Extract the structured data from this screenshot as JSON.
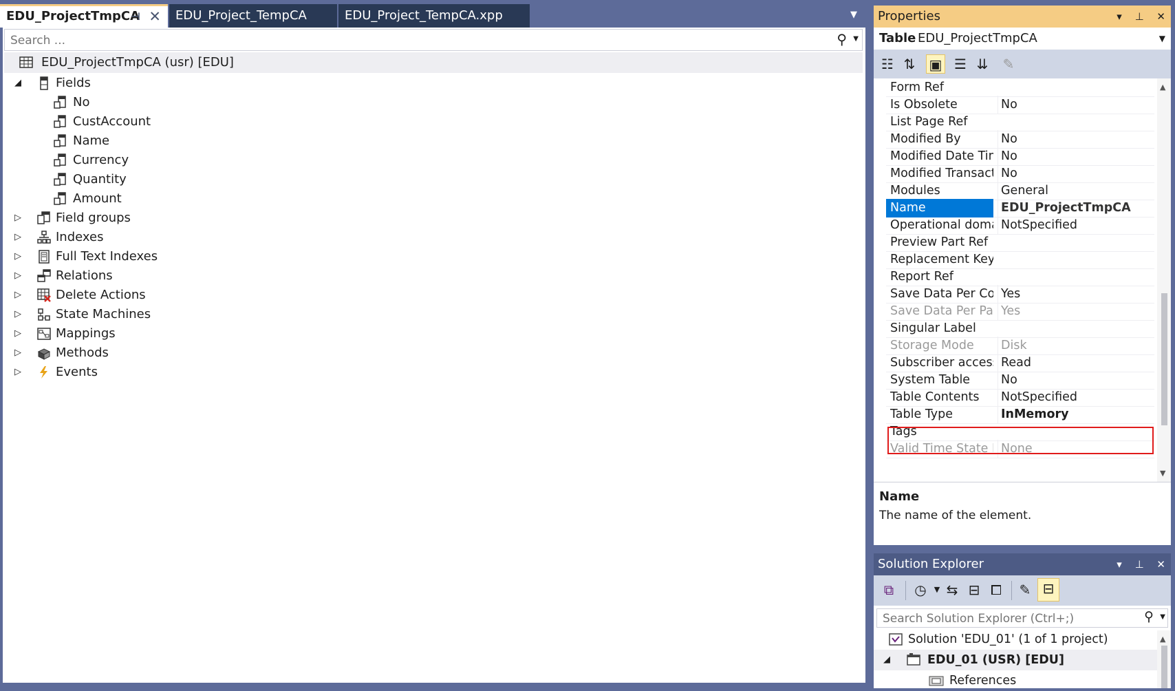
{
  "tabs": [
    {
      "label": "EDU_ProjectTmpCA",
      "active": true
    },
    {
      "label": "EDU_Project_TempCA",
      "active": false
    },
    {
      "label": "EDU_Project_TempCA.xpp",
      "active": false
    }
  ],
  "editor": {
    "search_placeholder": "Search ...",
    "root": "EDU_ProjectTmpCA (usr) [EDU]",
    "fields_node": "Fields",
    "fields": [
      "No",
      "CustAccount",
      "Name",
      "Currency",
      "Quantity",
      "Amount"
    ],
    "nodes": [
      "Field groups",
      "Indexes",
      "Full Text Indexes",
      "Relations",
      "Delete Actions",
      "State Machines",
      "Mappings",
      "Methods",
      "Events"
    ]
  },
  "properties": {
    "title": "Properties",
    "object_kind": "Table",
    "object_name": "EDU_ProjectTmpCA",
    "rows": [
      {
        "name": "Form Ref",
        "value": ""
      },
      {
        "name": "Is Obsolete",
        "value": "No"
      },
      {
        "name": "List Page Ref",
        "value": ""
      },
      {
        "name": "Modified By",
        "value": "No"
      },
      {
        "name": "Modified Date Time",
        "value": "No"
      },
      {
        "name": "Modified TransactionId",
        "value": "No"
      },
      {
        "name": "Modules",
        "value": "General"
      },
      {
        "name": "Name",
        "value": "EDU_ProjectTmpCA"
      },
      {
        "name": "Operational domain",
        "value": "NotSpecified"
      },
      {
        "name": "Preview Part Ref",
        "value": ""
      },
      {
        "name": "Replacement Key",
        "value": ""
      },
      {
        "name": "Report Ref",
        "value": ""
      },
      {
        "name": "Save Data Per Company",
        "value": "Yes"
      },
      {
        "name": "Save Data Per Partition",
        "value": "Yes"
      },
      {
        "name": "Singular Label",
        "value": ""
      },
      {
        "name": "Storage Mode",
        "value": "Disk"
      },
      {
        "name": "Subscriber access level",
        "value": "Read"
      },
      {
        "name": "System Table",
        "value": "No"
      },
      {
        "name": "Table Contents",
        "value": "NotSpecified"
      },
      {
        "name": "Table Type",
        "value": "InMemory"
      },
      {
        "name": "Tags",
        "value": ""
      },
      {
        "name": "Valid Time State Field Type",
        "value": "None"
      }
    ],
    "desc_title": "Name",
    "desc_text": "The name of the element."
  },
  "solution_explorer": {
    "title": "Solution Explorer",
    "search_placeholder": "Search Solution Explorer (Ctrl+;)",
    "solution": "Solution 'EDU_01' (1 of 1 project)",
    "project": "EDU_01 (USR) [EDU]",
    "references": "References"
  }
}
